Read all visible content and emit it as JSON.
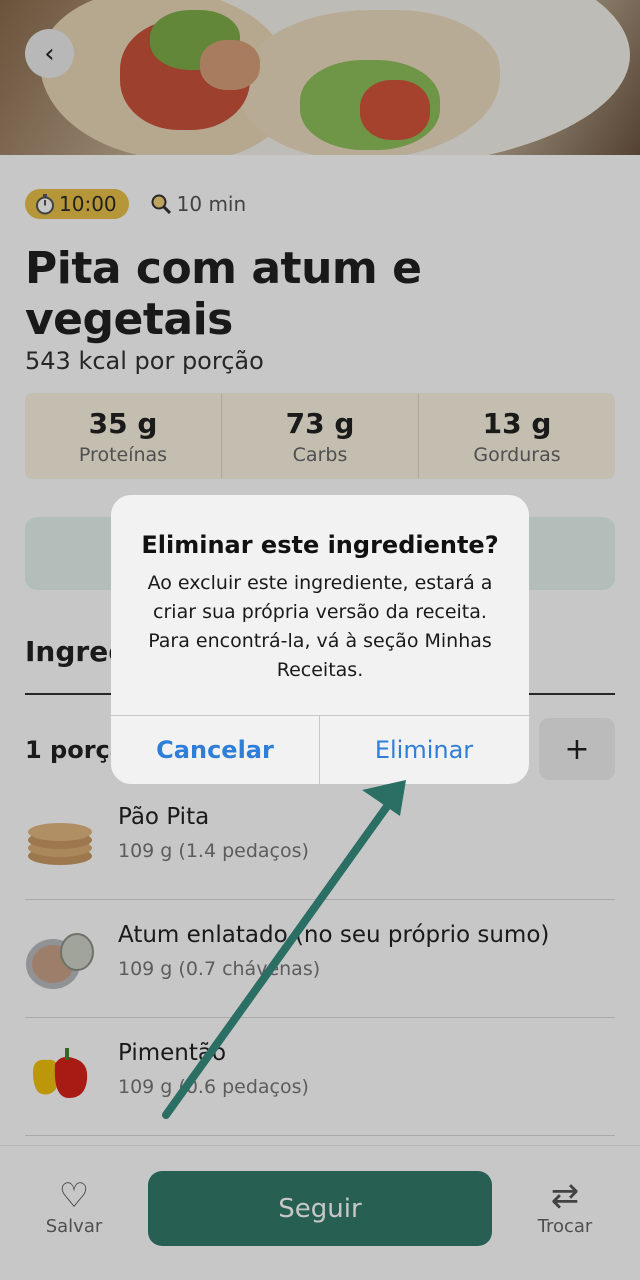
{
  "hero": {
    "back_icon": "chevron-left-icon",
    "back_glyph": "‹"
  },
  "meta": {
    "timer": "10:00",
    "timer_icon": "stopwatch-icon",
    "cook_time": "10 min",
    "cook_icon": "frying-pan-icon"
  },
  "recipe": {
    "title": "Pita com atum e vegetais",
    "kcal": "543 kcal por porção"
  },
  "macros": [
    {
      "value": "35 g",
      "label": "Proteínas"
    },
    {
      "value": "73 g",
      "label": "Carbs"
    },
    {
      "value": "13 g",
      "label": "Gorduras"
    }
  ],
  "ingredients_section": {
    "title": "Ingredientes",
    "portion_label": "1 porção",
    "add_glyph": "+"
  },
  "ingredients": [
    {
      "name": "Pão Pita",
      "amount": "109 g (1.4 pedaços)",
      "icon": "pita-bread-image"
    },
    {
      "name": "Atum enlatado (no seu próprio sumo)",
      "amount": "109 g (0.7 chávenas)",
      "icon": "canned-tuna-image"
    },
    {
      "name": "Pimentão",
      "amount": "109 g (0.6 pedaços)",
      "icon": "bell-pepper-image"
    }
  ],
  "bottom_bar": {
    "save_label": "Salvar",
    "save_glyph": "♡",
    "follow_label": "Seguir",
    "swap_label": "Trocar",
    "swap_glyph": "⇄"
  },
  "alert": {
    "title": "Eliminar este ingrediente?",
    "message": "Ao excluir este ingrediente, estará a criar sua própria versão da receita. Para encontrá-la, vá à seção Minhas Receitas.",
    "cancel": "Cancelar",
    "confirm": "Eliminar"
  },
  "colors": {
    "accent": "#327a6b",
    "timer_badge": "#e8c048",
    "alert_button": "#2f7ed8",
    "annotation_arrow": "#2a6e64"
  }
}
